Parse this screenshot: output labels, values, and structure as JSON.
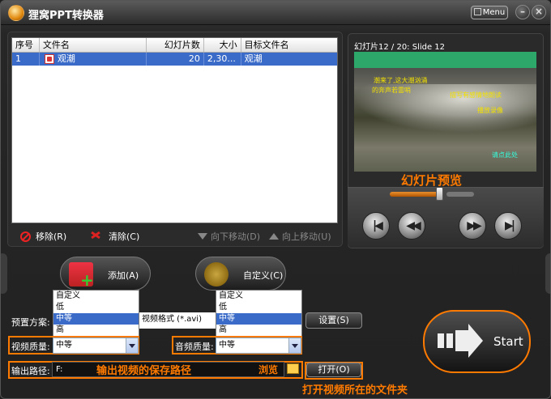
{
  "app": {
    "title": "狸窝PPT转换器",
    "menu_label": "Menu",
    "min": "–",
    "close": "×"
  },
  "table": {
    "headers": [
      "序号",
      "文件名",
      "幻灯片数",
      "大小",
      "目标文件名"
    ],
    "rows": [
      {
        "idx": "1",
        "name": "观潮",
        "slides": "20",
        "size": "2,30...",
        "target": "观潮"
      }
    ]
  },
  "toolbar": {
    "remove": "移除(R)",
    "clear": "清除(C)",
    "down": "向下移动(D)",
    "up": "向上移动(U)"
  },
  "preview": {
    "label": "幻灯片12 / 20: Slide 12",
    "overlay": "幻灯片预览",
    "slide_lines": [
      "潮来了,这大潮汹涌",
      "的奔声若雷哨",
      "描写有感情地朗读",
      "播放录像",
      "请点此处"
    ],
    "progress_pct": 0.59
  },
  "buttons": {
    "add": "添加(A)",
    "custom": "自定义(C)",
    "settings": "设置(S)",
    "open": "打开(O)",
    "start": "Start",
    "browse": "浏览"
  },
  "preset": {
    "label": "预置方案:",
    "value": "视频格式 (*.avi)"
  },
  "video_quality": {
    "label": "视频质量:",
    "value": "中等",
    "options": [
      "自定义",
      "低",
      "中等",
      "高"
    ],
    "selected": "中等"
  },
  "audio_quality": {
    "label": "音频质量:",
    "value": "中等",
    "options": [
      "自定义",
      "低",
      "中等",
      "高"
    ],
    "selected": "中等"
  },
  "output": {
    "label": "输出路径:",
    "value": "F:",
    "annotation": "输出视频的保存路径",
    "open_annotation": "打开视频所在的文件夹"
  }
}
